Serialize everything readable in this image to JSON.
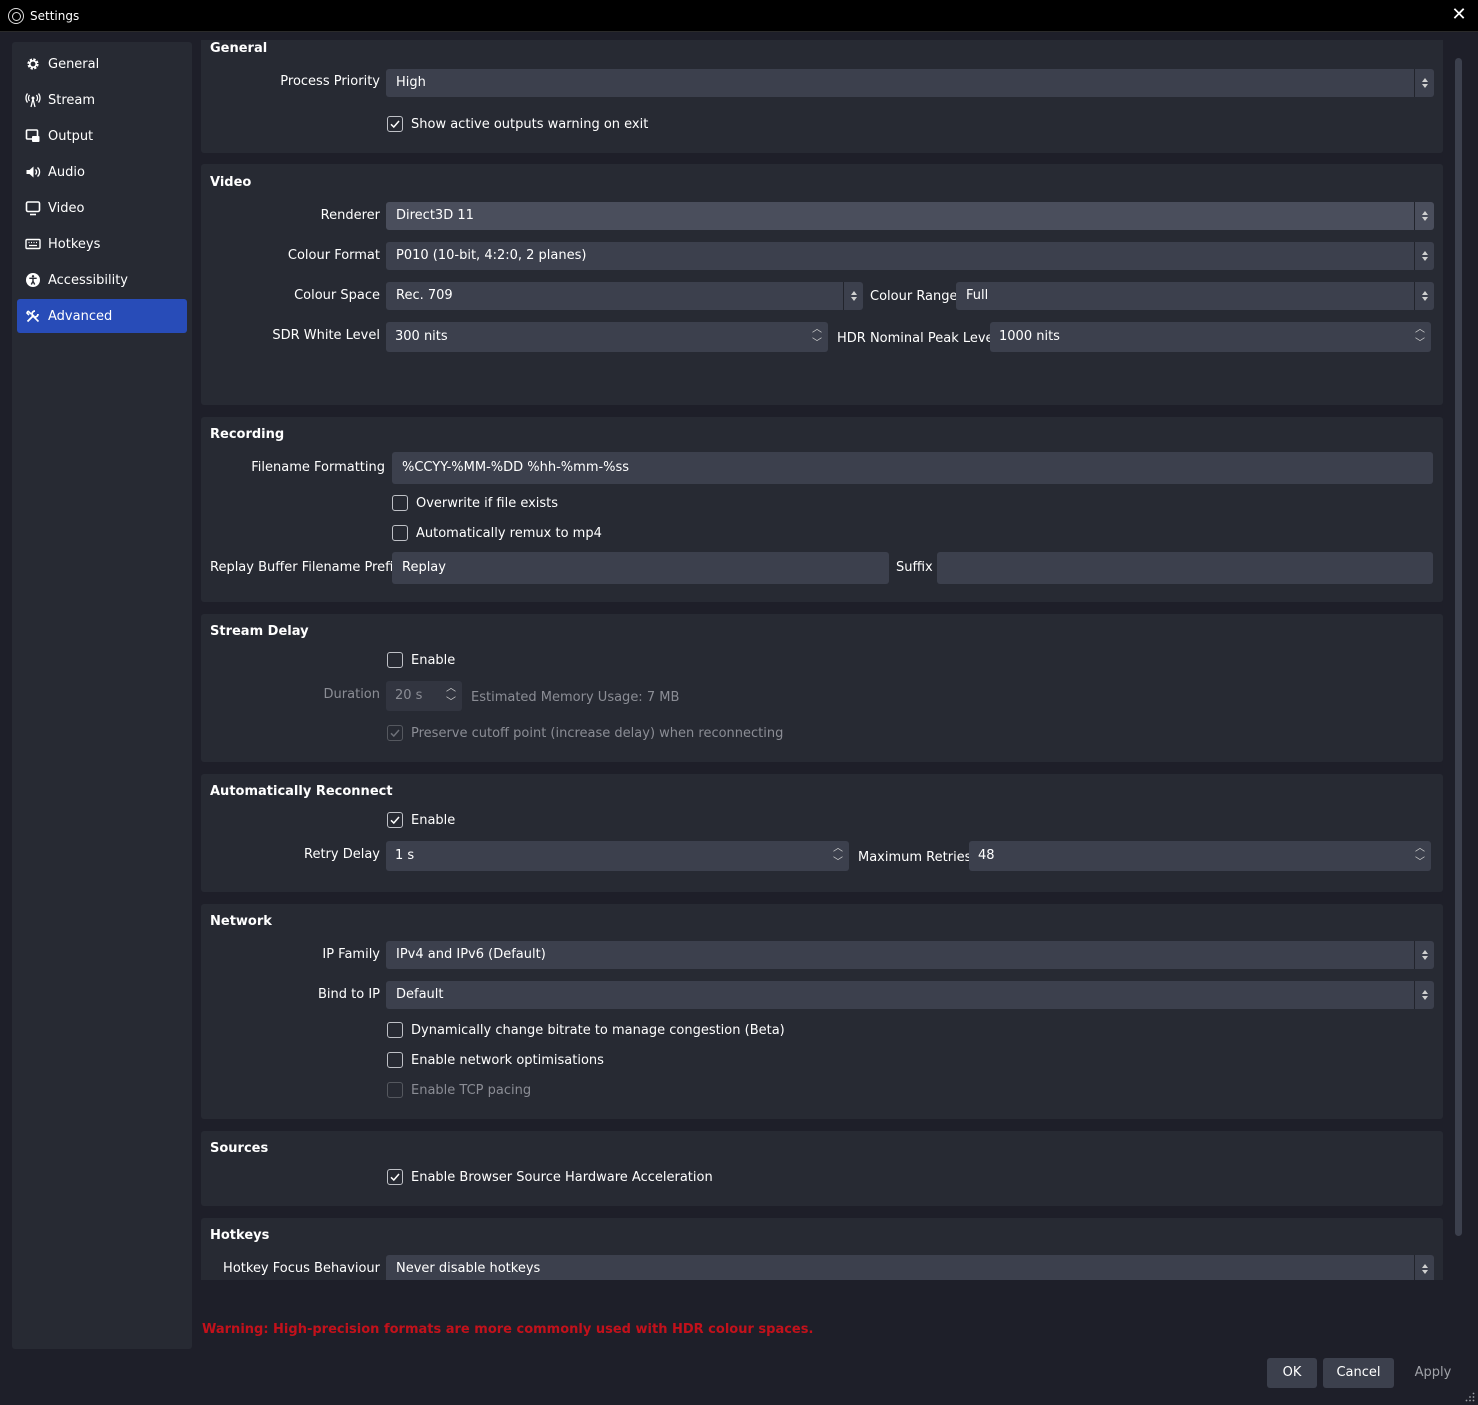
{
  "window": {
    "title": "Settings",
    "close_glyph": "✕"
  },
  "sidebar": {
    "items": [
      {
        "label": "General",
        "icon": "gear-icon"
      },
      {
        "label": "Stream",
        "icon": "antenna-icon"
      },
      {
        "label": "Output",
        "icon": "output-icon"
      },
      {
        "label": "Audio",
        "icon": "speaker-icon"
      },
      {
        "label": "Video",
        "icon": "monitor-icon"
      },
      {
        "label": "Hotkeys",
        "icon": "keyboard-icon"
      },
      {
        "label": "Accessibility",
        "icon": "accessibility-icon"
      },
      {
        "label": "Advanced",
        "icon": "tools-icon",
        "active": true
      }
    ]
  },
  "general": {
    "title": "General",
    "process_priority_label": "Process Priority",
    "process_priority_value": "High",
    "show_warning_label": "Show active outputs warning on exit",
    "show_warning_checked": true
  },
  "video": {
    "title": "Video",
    "renderer_label": "Renderer",
    "renderer_value": "Direct3D 11",
    "colour_format_label": "Colour Format",
    "colour_format_value": "P010 (10-bit, 4:2:0, 2 planes)",
    "colour_space_label": "Colour Space",
    "colour_space_value": "Rec. 709",
    "colour_range_label": "Colour Range",
    "colour_range_value": "Full",
    "sdr_label": "SDR White Level",
    "sdr_value": "300 nits",
    "hdr_label": "HDR Nominal Peak Level",
    "hdr_value": "1000 nits"
  },
  "recording": {
    "title": "Recording",
    "filename_label": "Filename Formatting",
    "filename_value": "%CCYY-%MM-%DD %hh-%mm-%ss",
    "overwrite_label": "Overwrite if file exists",
    "remux_label": "Automatically remux to mp4",
    "replay_prefix_label": "Replay Buffer Filename Prefix",
    "replay_prefix_value": "Replay",
    "suffix_label": "Suffix",
    "suffix_value": ""
  },
  "stream_delay": {
    "title": "Stream Delay",
    "enable_label": "Enable",
    "duration_label": "Duration",
    "duration_value": "20 s",
    "memory_text": "Estimated Memory Usage: 7 MB",
    "preserve_label": "Preserve cutoff point (increase delay) when reconnecting"
  },
  "reconnect": {
    "title": "Automatically Reconnect",
    "enable_label": "Enable",
    "retry_delay_label": "Retry Delay",
    "retry_delay_value": "1 s",
    "max_retries_label": "Maximum Retries",
    "max_retries_value": "48"
  },
  "network": {
    "title": "Network",
    "ip_family_label": "IP Family",
    "ip_family_value": "IPv4 and IPv6 (Default)",
    "bind_label": "Bind to IP",
    "bind_value": "Default",
    "dynamic_bitrate_label": "Dynamically change bitrate to manage congestion (Beta)",
    "network_opt_label": "Enable network optimisations",
    "tcp_pacing_label": "Enable TCP pacing"
  },
  "sources": {
    "title": "Sources",
    "browser_accel_label": "Enable Browser Source Hardware Acceleration"
  },
  "hotkeys": {
    "title": "Hotkeys",
    "focus_label": "Hotkey Focus Behaviour",
    "focus_value": "Never disable hotkeys"
  },
  "warning": "Warning: High-precision formats are more commonly used with HDR colour spaces.",
  "buttons": {
    "ok": "OK",
    "cancel": "Cancel",
    "apply": "Apply"
  },
  "colors": {
    "accent": "#284cb8",
    "warning": "#c3111b",
    "panel": "#272a33",
    "background": "#1e1f29",
    "control": "#3c404d"
  }
}
